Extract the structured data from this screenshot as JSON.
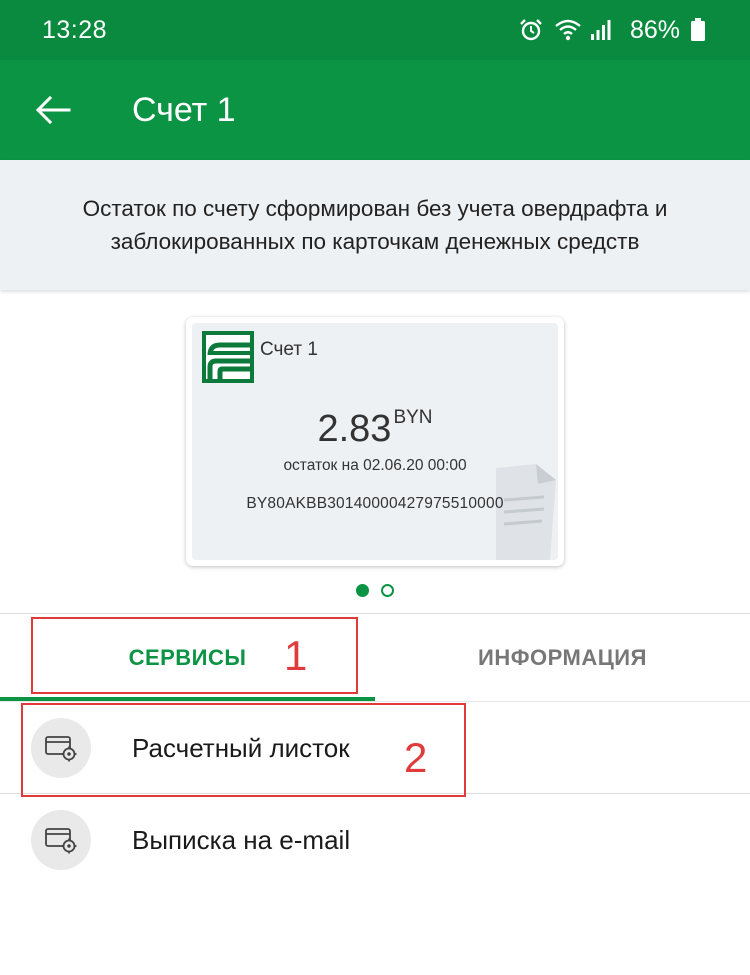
{
  "status_bar": {
    "time": "13:28",
    "battery": "86%",
    "icons": [
      "alarm-icon",
      "wifi-icon",
      "signal-icon",
      "battery-icon"
    ]
  },
  "app_bar": {
    "title": "Счет 1",
    "back_icon": "arrow-left-icon"
  },
  "notice": {
    "text": "Остаток по счету сформирован без учета овердрафта и заблокированных по карточкам денежных средств"
  },
  "account_card": {
    "name": "Счет 1",
    "amount": "2.83",
    "currency": "BYN",
    "balance_label": "остаток на 02.06.20 00:00",
    "iban": "BY80AKBB30140000427975510000"
  },
  "pager": {
    "count": 2,
    "active": 1
  },
  "tabs": [
    {
      "label": "СЕРВИСЫ",
      "active": true
    },
    {
      "label": "ИНФОРМАЦИЯ",
      "active": false
    }
  ],
  "services": [
    {
      "label": "Расчетный листок",
      "icon": "card-settings-icon"
    },
    {
      "label": "Выписка на e-mail",
      "icon": "card-settings-icon"
    }
  ],
  "annotations": [
    {
      "number": "1"
    },
    {
      "number": "2"
    }
  ],
  "colors": {
    "brand_green": "#0b9444",
    "status_green": "#0a8a3e",
    "annotation_red": "#e03a3a"
  }
}
